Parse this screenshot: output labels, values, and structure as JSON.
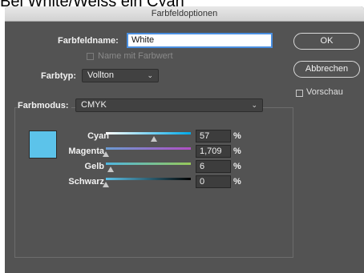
{
  "caption": "Bei White/Weiss ein Cyan",
  "dialog": {
    "title": "Farbfeldoptionen",
    "swatch_name_label": "Farbfeldname:",
    "swatch_name_value": "White",
    "name_with_value_label": "Name mit Farbwert",
    "color_type_label": "Farbtyp:",
    "color_type_value": "Vollton",
    "color_mode_label": "Farbmodus:",
    "color_mode_value": "CMYK",
    "ok_label": "OK",
    "cancel_label": "Abbrechen",
    "preview_label": "Vorschau",
    "swatch_color": "#5cc3ea",
    "sliders": [
      {
        "label": "Cyan",
        "value": "57",
        "unit": "%",
        "level": 0.57
      },
      {
        "label": "Magenta",
        "value": "1,709",
        "unit": "%",
        "level": 0.0
      },
      {
        "label": "Gelb",
        "value": "6",
        "unit": "%",
        "level": 0.06
      },
      {
        "label": "Schwarz",
        "value": "0",
        "unit": "%",
        "level": 0.0
      }
    ]
  }
}
